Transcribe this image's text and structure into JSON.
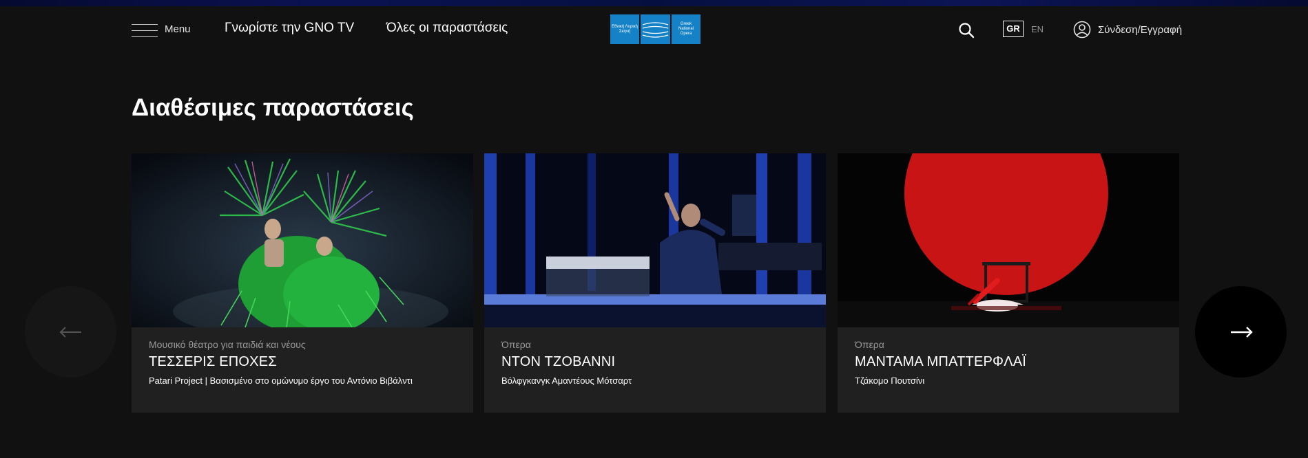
{
  "nav": {
    "menu_label": "Menu",
    "links": [
      "Γνωρίστε την GNO TV",
      "Όλες οι παραστάσεις"
    ],
    "logo": {
      "left_text": "Εθνική Λυρική Σκηνή",
      "right_text": "Greek National Opera"
    },
    "lang_active": "GR",
    "lang_other": "EN",
    "login_label": "Σύνδεση/Εγγραφή"
  },
  "section": {
    "title": "Διαθέσιμες παραστάσεις"
  },
  "cards": [
    {
      "category": "Μουσικό θέατρο για παιδιά και νέους",
      "title": "ΤΕΣΣΕΡΙΣ ΕΠΟΧΕΣ",
      "subtitle": "Patari Project | Βασισμένο στο ομώνυμο έργο του Αντόνιο Βιβάλντι"
    },
    {
      "category": "Όπερα",
      "title": "ΝΤΟΝ ΤΖΟΒΑΝΝΙ",
      "subtitle": "Βόλφγκανγκ Αμαντέους Μότσαρτ"
    },
    {
      "category": "Όπερα",
      "title": "ΜΑΝΤΑΜΑ ΜΠΑΤΤΕΡΦΛΑΪ",
      "subtitle": "Τζάκομο Πουτσίνι"
    }
  ],
  "colors": {
    "background": "#111111",
    "card": "#202020",
    "logo_blue": "#1582c8"
  },
  "icons": {
    "menu": "hamburger-icon",
    "search": "search-icon",
    "user": "user-icon",
    "prev": "arrow-left-icon",
    "next": "arrow-right-icon"
  }
}
